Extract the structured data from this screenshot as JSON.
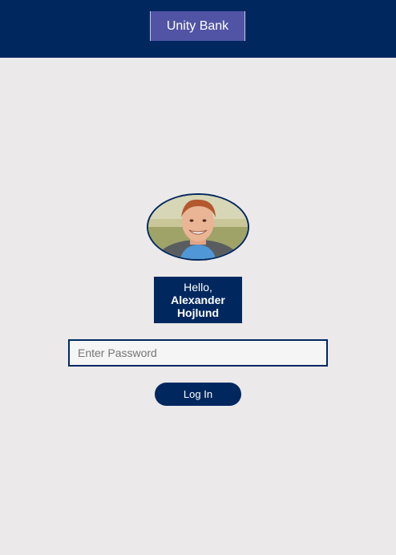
{
  "header": {
    "brand": "Unity Bank"
  },
  "profile": {
    "greeting": "Hello,",
    "first_name": "Alexander",
    "last_name": "Hojlund"
  },
  "login": {
    "password_placeholder": "Enter Password",
    "password_value": "",
    "button_label": "Log In"
  },
  "colors": {
    "primary": "#00285f",
    "brand_button": "#5154a4",
    "background": "#ebe9ea"
  }
}
